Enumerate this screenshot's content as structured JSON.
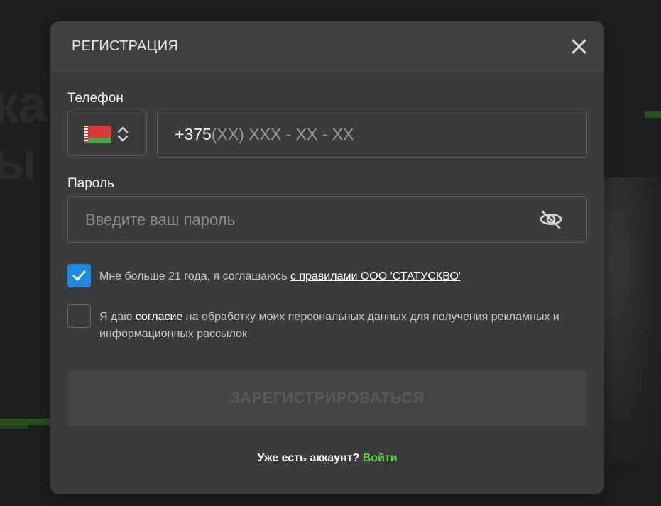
{
  "background": {
    "partial_text_lines": [
      "ка",
      "ы"
    ]
  },
  "modal": {
    "title": "РЕГИСТРАЦИЯ",
    "close_icon": "close-icon"
  },
  "phone": {
    "label": "Телефон",
    "country_flag": "belarus-flag-icon",
    "country_chevron_icon": "chevron-up-down-icon",
    "prefix": "+375",
    "mask": "(XX) XXX - XX - XX"
  },
  "password": {
    "label": "Пароль",
    "placeholder": "Введите ваш пароль",
    "visibility_icon": "eye-slash-icon"
  },
  "consents": [
    {
      "checked": true,
      "text_before": "Мне больше 21 года, я соглашаюсь ",
      "link_text": "с правилами ООО 'СТАТУСКВО'",
      "text_after": ""
    },
    {
      "checked": false,
      "text_before": "Я даю ",
      "link_text": "согласие",
      "text_after": " на обработку моих персональных данных для получения рекламных и информационных рассылок"
    }
  ],
  "submit": {
    "label": "ЗАРЕГИСТРИРОВАТЬСЯ",
    "disabled": true
  },
  "login": {
    "question": "Уже есть аккаунт?",
    "link_text": "Войти"
  },
  "colors": {
    "accent_blue": "#1e88e5",
    "login_link_green": "#5fd33a",
    "modal_bg": "#3b3b3b"
  }
}
